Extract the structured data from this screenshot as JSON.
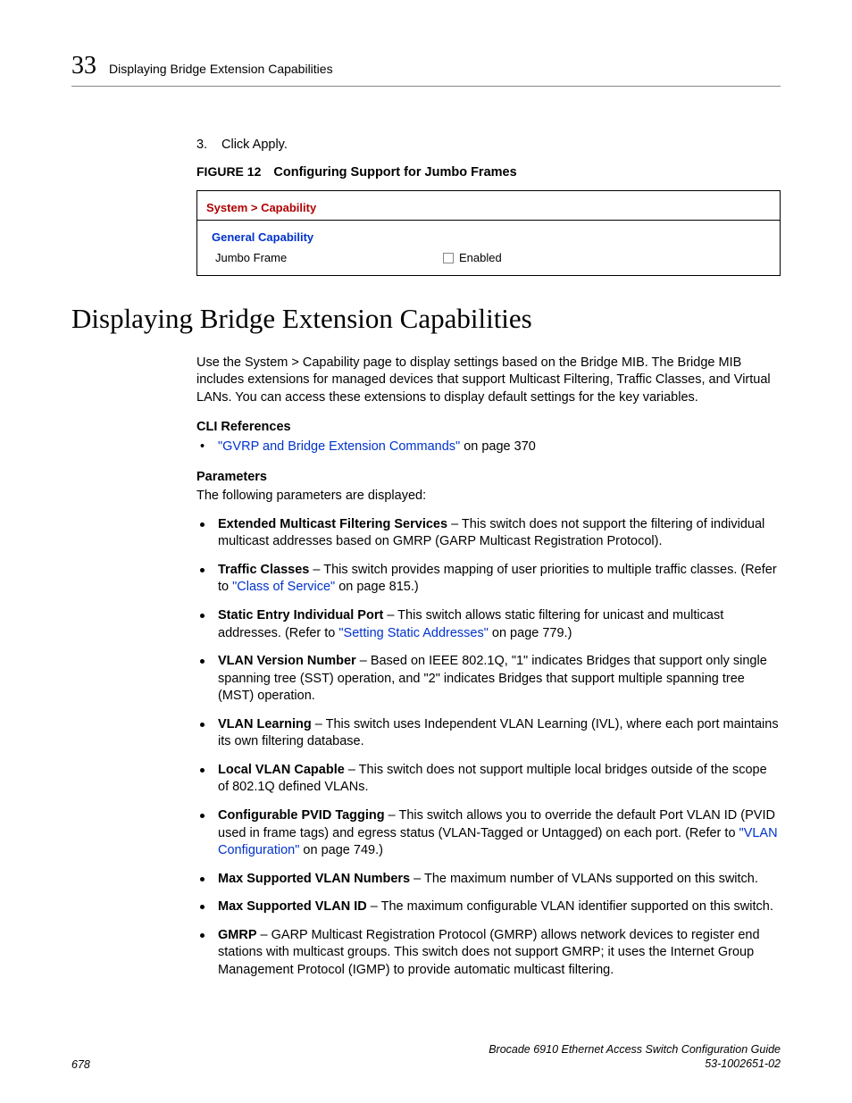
{
  "header": {
    "chapter_num": "33",
    "title": "Displaying Bridge Extension Capabilities"
  },
  "step": {
    "num": "3.",
    "text": "Click Apply."
  },
  "figure": {
    "label": "FIGURE 12",
    "caption": "Configuring Support for Jumbo Frames",
    "breadcrumb": "System > Capability",
    "section_title": "General Capability",
    "row_label": "Jumbo Frame",
    "check_label": "Enabled"
  },
  "h1": "Displaying Bridge Extension Capabilities",
  "intro": "Use the System > Capability page to display settings based on the Bridge MIB. The Bridge MIB includes extensions for managed devices that support Multicast Filtering, Traffic Classes, and Virtual LANs. You can access these extensions to display default settings for the key variables.",
  "cli_head": "CLI References",
  "cli_link": "\"GVRP and Bridge Extension Commands\"",
  "cli_tail": " on page 370",
  "params_head": "Parameters",
  "params_intro": "The following parameters are displayed:",
  "params": [
    {
      "name": "Extended Multicast Filtering Services",
      "pre": " – This switch does not support the filtering of individual multicast addresses based on GMRP (GARP Multicast Registration Protocol).",
      "link": "",
      "post": ""
    },
    {
      "name": "Traffic Classes",
      "pre": " – This switch provides mapping of user priorities to multiple traffic classes. (Refer to ",
      "link": "\"Class of Service\"",
      "post": " on page 815.)"
    },
    {
      "name": "Static Entry Individual Port",
      "pre": " – This switch allows static filtering for unicast and multicast addresses. (Refer to ",
      "link": "\"Setting Static Addresses\"",
      "post": " on page 779.)"
    },
    {
      "name": "VLAN Version Number",
      "pre": " – Based on IEEE 802.1Q, \"1\" indicates Bridges that support only single spanning tree (SST) operation, and \"2\" indicates Bridges that support multiple spanning tree (MST) operation.",
      "link": "",
      "post": ""
    },
    {
      "name": "VLAN Learning",
      "pre": " – This switch uses Independent VLAN Learning (IVL), where each port maintains its own filtering database.",
      "link": "",
      "post": ""
    },
    {
      "name": "Local VLAN Capable",
      "pre": " – This switch does not support multiple local bridges outside of the scope of 802.1Q defined VLANs.",
      "link": "",
      "post": ""
    },
    {
      "name": "Configurable PVID Tagging",
      "pre": " – This switch allows you to override the default Port VLAN ID (PVID used in frame tags) and egress status (VLAN-Tagged or Untagged) on each port. (Refer to ",
      "link": "\"VLAN Configuration\"",
      "post": " on page 749.)"
    },
    {
      "name": "Max Supported VLAN Numbers",
      "pre": " – The maximum number of VLANs supported on this switch.",
      "link": "",
      "post": ""
    },
    {
      "name": "Max Supported VLAN ID",
      "pre": " – The maximum configurable VLAN identifier supported on this switch.",
      "link": "",
      "post": ""
    },
    {
      "name": "GMRP",
      "pre": " – GARP Multicast Registration Protocol (GMRP) allows network devices to register end stations with multicast groups. This switch does not support GMRP; it uses the Internet Group Management Protocol (IGMP) to provide automatic multicast filtering.",
      "link": "",
      "post": ""
    }
  ],
  "footer": {
    "page_num": "678",
    "doc_title": "Brocade 6910 Ethernet Access Switch Configuration Guide",
    "doc_id": "53-1002651-02"
  }
}
